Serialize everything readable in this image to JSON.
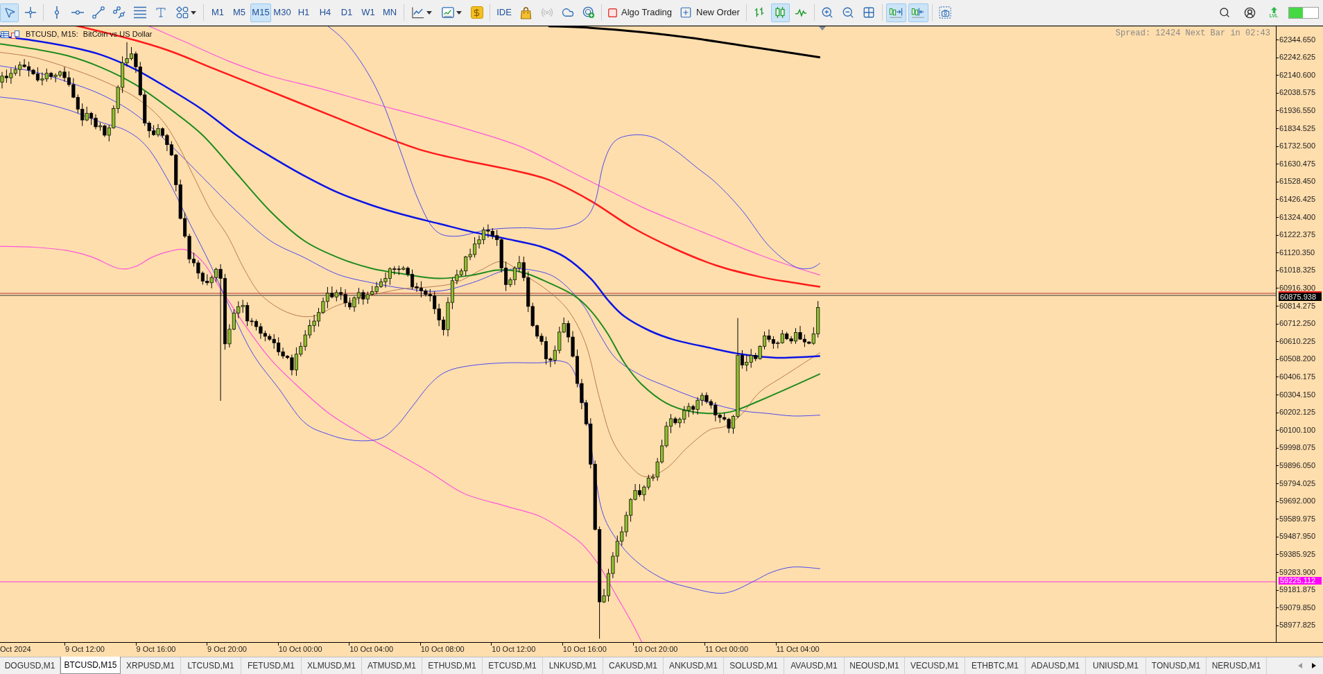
{
  "toolbar": {
    "tools": [
      {
        "kind": "cursor",
        "selected": true
      },
      {
        "kind": "crosshair",
        "selected": false
      }
    ],
    "timeframes": [
      {
        "label": "M1",
        "selected": false
      },
      {
        "label": "M5",
        "selected": false
      },
      {
        "label": "M15",
        "selected": true
      },
      {
        "label": "M30",
        "selected": false
      },
      {
        "label": "H1",
        "selected": false
      },
      {
        "label": "H4",
        "selected": false
      },
      {
        "label": "D1",
        "selected": false
      },
      {
        "label": "W1",
        "selected": false
      },
      {
        "label": "MN",
        "selected": false
      }
    ],
    "platform": [
      {
        "kind": "ide",
        "label": "IDE",
        "disabled": false
      },
      {
        "kind": "market",
        "disabled": false
      },
      {
        "kind": "signals",
        "disabled": true
      },
      {
        "kind": "vps",
        "disabled": false
      },
      {
        "kind": "community",
        "disabled": false
      }
    ],
    "algo_trading": {
      "label": "Algo Trading",
      "on": false
    },
    "new_order": {
      "label": "New Order"
    },
    "chart_styles": [
      {
        "kind": "bars",
        "selected": false
      },
      {
        "kind": "candles",
        "selected": true
      },
      {
        "kind": "line",
        "selected": false
      }
    ],
    "scroll": [
      {
        "kind": "autoscroll",
        "selected": true
      },
      {
        "kind": "chart-shift",
        "selected": true
      }
    ],
    "lvl": {
      "label": "LVL"
    },
    "meter": {
      "level": 0.47
    }
  },
  "chart": {
    "symbol": "BTCUSD, M15:",
    "description": "BitCoin vs US Dollar",
    "info": "Spread: 12424 Next Bar in 02:43",
    "price_ticks": [
      "62344.650",
      "62242.625",
      "62140.600",
      "62038.575",
      "61936.550",
      "61834.525",
      "61732.500",
      "61630.475",
      "61528.450",
      "61426.425",
      "61324.400",
      "61222.375",
      "61120.350",
      "61018.325",
      "60916.300",
      "60814.275",
      "60712.250",
      "60610.225",
      "60508.200",
      "60406.175",
      "60304.150",
      "60202.125",
      "60100.100",
      "59998.075",
      "59896.050",
      "59794.025",
      "59692.000",
      "59589.975",
      "59487.950",
      "59385.925",
      "59283.900",
      "59181.875",
      "59079.850",
      "58977.825"
    ],
    "bid_label": "60875.938",
    "line_label": "59225.112",
    "time_ticks": [
      "Oct 2024",
      "9 Oct 12:00",
      "9 Oct 16:00",
      "9 Oct 20:00",
      "10 Oct 00:00",
      "10 Oct 04:00",
      "10 Oct 08:00",
      "10 Oct 12:00",
      "10 Oct 16:00",
      "10 Oct 20:00",
      "11 Oct 00:00",
      "11 Oct 04:00"
    ]
  },
  "tabs": [
    {
      "label": "DOGUSD,M1",
      "selected": false
    },
    {
      "label": "BTCUSD,M15",
      "selected": true
    },
    {
      "label": "XRPUSD,M1",
      "selected": false
    },
    {
      "label": "LTCUSD,M1",
      "selected": false
    },
    {
      "label": "FETUSD,M1",
      "selected": false
    },
    {
      "label": "XLMUSD,M1",
      "selected": false
    },
    {
      "label": "ATMUSD,M1",
      "selected": false
    },
    {
      "label": "ETHUSD,M1",
      "selected": false
    },
    {
      "label": "ETCUSD,M1",
      "selected": false
    },
    {
      "label": "LNKUSD,M1",
      "selected": false
    },
    {
      "label": "CAKUSD,M1",
      "selected": false
    },
    {
      "label": "ANKUSD,M1",
      "selected": false
    },
    {
      "label": "SOLUSD,M1",
      "selected": false
    },
    {
      "label": "AVAUSD,M1",
      "selected": false
    },
    {
      "label": "NEOUSD,M1",
      "selected": false
    },
    {
      "label": "VECUSD,M1",
      "selected": false
    },
    {
      "label": "ETHBTC,M1",
      "selected": false
    },
    {
      "label": "ADAUSD,M1",
      "selected": false
    },
    {
      "label": "UNIUSD,M1",
      "selected": false
    },
    {
      "label": "TONUSD,M1",
      "selected": false
    },
    {
      "label": "NERUSD,M1",
      "selected": false
    }
  ]
}
